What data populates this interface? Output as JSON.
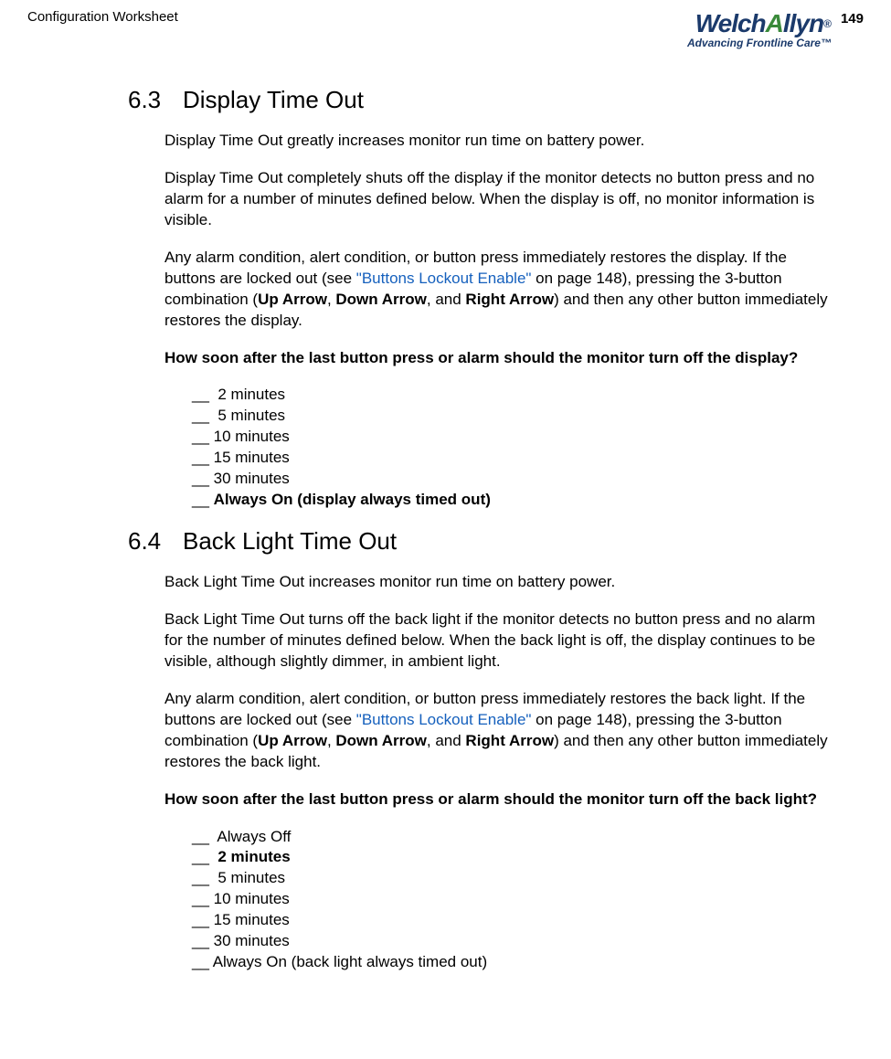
{
  "header": {
    "title": "Configuration Worksheet",
    "page": "149",
    "logo": {
      "welch": "Welch",
      "a": "A",
      "llyn": "llyn",
      "reg": "®"
    },
    "tagline": "Advancing Frontline Care™"
  },
  "section63": {
    "num": "6.3",
    "title": "Display Time Out",
    "p1": "Display Time Out greatly increases monitor run time on battery power.",
    "p2": "Display Time Out completely shuts off the display if the monitor detects no button press and no alarm for a number of minutes defined below. When the display is off, no monitor information is visible.",
    "p3a": "Any alarm condition, alert condition, or button press immediately restores the display. If the buttons are locked out (see ",
    "p3link": "\"Buttons Lockout Enable\"",
    "p3b": " on page 148), pressing the 3-button combination (",
    "p3up": "Up Arrow",
    "p3c": ", ",
    "p3down": "Down Arrow",
    "p3d": ", and ",
    "p3right": "Right Arrow",
    "p3e": ") and then any other button immediately restores the display.",
    "q": "How soon after the last button press or alarm should the monitor turn off the display?",
    "opts": {
      "o1": "__  2 minutes",
      "o2": "__  5 minutes",
      "o3": "__ 10 minutes",
      "o4": "__ 15 minutes",
      "o5": "__ 30 minutes",
      "o6pre": "__ ",
      "o6": "Always On (display always timed out)"
    }
  },
  "section64": {
    "num": "6.4",
    "title": "Back Light Time Out",
    "p1": "Back Light Time Out increases monitor run time on battery power.",
    "p2": "Back Light Time Out turns off the back light if the monitor detects no button press and no alarm for the number of minutes defined below. When the back light is off, the display continues to be visible, although slightly dimmer, in ambient light.",
    "p3a": "Any alarm condition, alert condition, or button press immediately restores the back light. If the buttons are locked out (see ",
    "p3link": "\"Buttons Lockout Enable\"",
    "p3b": " on page 148), pressing the 3-button combination (",
    "p3up": "Up Arrow",
    "p3c": ", ",
    "p3down": "Down Arrow",
    "p3d": ", and ",
    "p3right": "Right Arrow",
    "p3e": ") and then any other button immediately restores the back light.",
    "q": "How soon after the last button press or alarm should the monitor turn off the back light?",
    "opts": {
      "o1": "__  Always Off",
      "o2pre": "__  ",
      "o2": "2 minutes",
      "o3": "__  5 minutes",
      "o4": "__ 10 minutes",
      "o5": "__ 15 minutes",
      "o6": "__ 30 minutes",
      "o7": "__ Always On (back light always timed out)"
    }
  }
}
